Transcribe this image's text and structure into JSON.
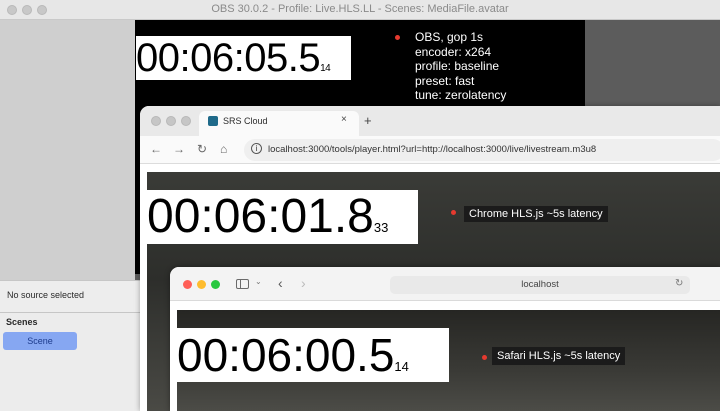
{
  "obs": {
    "title": "OBS 30.0.2 - Profile: Live.HLS.LL - Scenes: MediaFile.avatar",
    "clock_main": "00:06:05.5",
    "clock_frame": "14",
    "info_lines": [
      "OBS, gop 1s",
      "encoder: x264",
      "profile: baseline",
      "preset: fast",
      "tune: zerolatency"
    ],
    "sources_empty_text": "No source selected",
    "scenes_heading": "Scenes",
    "scenes": [
      "Scene"
    ],
    "colors": {
      "scene_selected": "#86a7f2",
      "marker_dot": "#e53a2f"
    }
  },
  "chrome": {
    "tab_title": "SRS Cloud",
    "tab_close": "×",
    "new_tab": "+",
    "url": "localhost:3000/tools/player.html?url=http://localhost:3000/live/livestream.m3u8",
    "icons": [
      "back-icon",
      "forward-icon",
      "reload-icon",
      "home-icon",
      "site-info-icon"
    ],
    "clock_main": "00:06:01.8",
    "clock_frame": "33",
    "label": "Chrome HLS.js ~5s latency"
  },
  "safari": {
    "address": "localhost",
    "clock_main": "00:06:00.5",
    "clock_frame": "14",
    "label": "Safari HLS.js ~5s latency",
    "colors": {
      "close": "#ff5f57",
      "minimize": "#febc2e",
      "zoom": "#28c840"
    }
  }
}
